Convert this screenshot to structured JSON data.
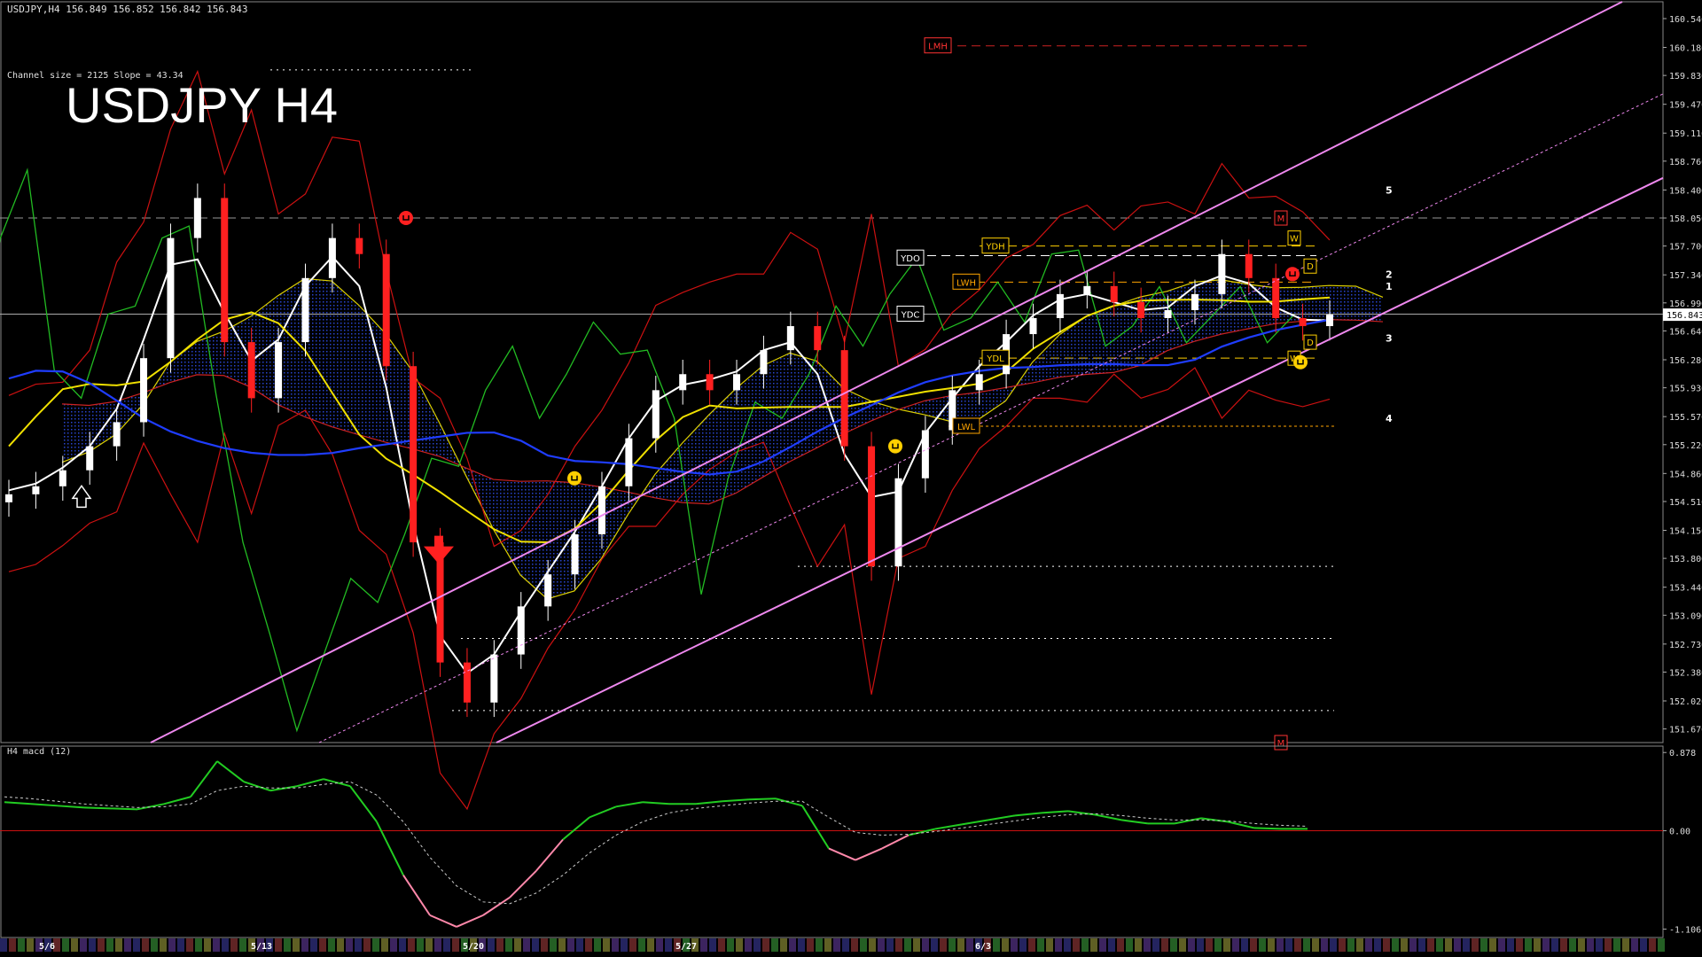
{
  "header": {
    "info": "USDJPY,H4  156.849 156.852 156.842 156.843",
    "channel_info": "Channel size = 2125 Slope = 43.34",
    "big_title": "USDJPY H4"
  },
  "chart_data": [
    {
      "type": "candlestick",
      "symbol": "USDJPY",
      "timeframe": "H4",
      "ohlc_last": {
        "open": 156.849,
        "high": 156.852,
        "low": 156.842,
        "close": 156.843
      },
      "current_price": "156.843",
      "ylim": [
        151.5,
        160.75
      ],
      "y_ticks": [
        "160.540",
        "160.180",
        "159.830",
        "159.470",
        "159.110",
        "158.760",
        "158.400",
        "158.050",
        "157.700",
        "157.340",
        "156.990",
        "156.640",
        "156.280",
        "155.930",
        "155.570",
        "155.220",
        "154.860",
        "154.510",
        "154.150",
        "153.800",
        "153.440",
        "153.090",
        "152.730",
        "152.380",
        "152.020",
        "151.670"
      ],
      "x_ticks": [
        "5/6",
        "5/13",
        "5/20",
        "5/27",
        "6/3"
      ],
      "close_path": [
        154.6,
        154.7,
        154.9,
        155.2,
        155.5,
        156.3,
        157.8,
        158.3,
        156.5,
        155.8,
        156.5,
        157.3,
        157.8,
        157.6,
        156.2,
        154.0,
        152.5,
        152.0,
        152.6,
        153.2,
        153.6,
        154.1,
        154.7,
        155.3,
        155.9,
        156.1,
        155.9,
        156.1,
        156.4,
        156.7,
        156.4,
        155.2,
        153.7,
        154.8,
        155.4,
        155.9,
        156.1,
        156.6,
        156.8,
        157.1,
        157.2,
        157.0,
        156.8,
        156.9,
        157.1,
        157.6,
        157.3,
        156.8,
        156.7,
        156.843
      ],
      "level_labels": [
        {
          "text": "LMH",
          "price": 160.2,
          "color": "#ff3333"
        },
        {
          "text": "YDO",
          "price": 157.55,
          "color": "#ffffff"
        },
        {
          "text": "YDH",
          "price": 157.7,
          "color": "#ffd000"
        },
        {
          "text": "LWH",
          "price": 157.25,
          "color": "#ffa500"
        },
        {
          "text": "YDC",
          "price": 156.85,
          "color": "#ffffff"
        },
        {
          "text": "YDL",
          "price": 156.3,
          "color": "#ffd000"
        },
        {
          "text": "LWL",
          "price": 155.45,
          "color": "#ffa500"
        }
      ],
      "box_markers": [
        {
          "text": "M",
          "price": 158.05,
          "color": "#ff3333"
        },
        {
          "text": "W",
          "price": 157.8,
          "color": "#ffd000"
        },
        {
          "text": "D",
          "price": 157.45,
          "color": "#ffd000"
        },
        {
          "text": "D",
          "price": 156.5,
          "color": "#ffd000"
        },
        {
          "text": "W",
          "price": 156.3,
          "color": "#ffd000"
        },
        {
          "text": "M",
          "price": 151.5,
          "color": "#ff3333"
        }
      ],
      "wave_labels": [
        {
          "text": "5",
          "price": 158.4
        },
        {
          "text": "2",
          "price": 157.35
        },
        {
          "text": "1",
          "price": 157.2
        },
        {
          "text": "3",
          "price": 156.55
        },
        {
          "text": "4",
          "price": 155.55
        }
      ]
    },
    {
      "type": "line",
      "title": "H4  macd (12)",
      "y_ticks": [
        "0.878",
        "0.00",
        "-1.106"
      ],
      "ylim": [
        -1.2,
        0.95
      ],
      "series": [
        {
          "color": "#22cc22",
          "values": [
            0.32,
            0.3,
            0.28,
            0.26,
            0.25,
            0.24,
            0.3,
            0.38,
            0.78,
            0.55,
            0.45,
            0.5,
            0.58,
            0.5,
            0.1,
            -0.5,
            -0.95,
            -1.08,
            -0.95,
            -0.75,
            -0.45,
            -0.1,
            0.15,
            0.27,
            0.32,
            0.3,
            0.3,
            0.33,
            0.35,
            0.36,
            0.28,
            -0.2,
            -0.33,
            -0.2,
            -0.05,
            0.02,
            0.07,
            0.12,
            0.17,
            0.2,
            0.22,
            0.18,
            0.12,
            0.08,
            0.08,
            0.14,
            0.1,
            0.03,
            0.02,
            0.02
          ]
        },
        {
          "color": "#cccccc",
          "values": [
            0.38,
            0.36,
            0.33,
            0.3,
            0.28,
            0.26,
            0.27,
            0.3,
            0.45,
            0.5,
            0.48,
            0.48,
            0.52,
            0.55,
            0.4,
            0.1,
            -0.3,
            -0.62,
            -0.8,
            -0.82,
            -0.7,
            -0.5,
            -0.25,
            -0.05,
            0.1,
            0.2,
            0.25,
            0.28,
            0.31,
            0.33,
            0.33,
            0.15,
            -0.02,
            -0.05,
            -0.04,
            -0.01,
            0.03,
            0.07,
            0.11,
            0.15,
            0.18,
            0.19,
            0.17,
            0.14,
            0.12,
            0.12,
            0.11,
            0.08,
            0.06,
            0.05
          ]
        }
      ]
    }
  ]
}
